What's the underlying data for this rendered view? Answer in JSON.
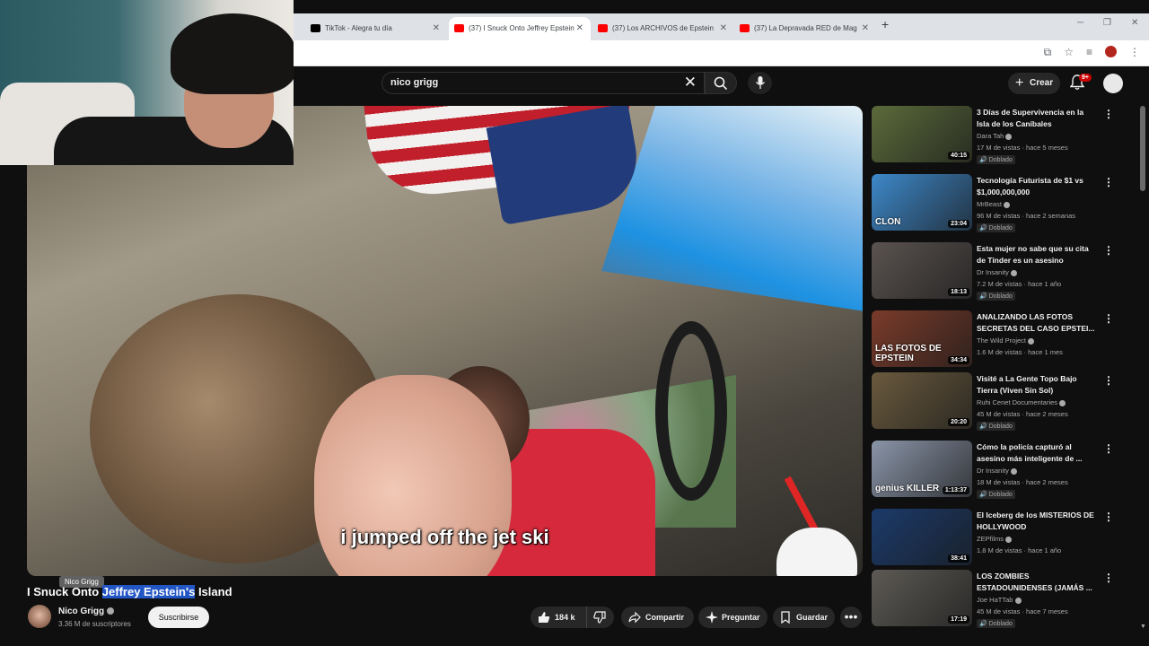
{
  "browser": {
    "tabs": [
      {
        "title": "TikTok - Alegra tu día",
        "icon": "tiktok-icon"
      },
      {
        "title": "(37) I Snuck Onto Jeffrey Epstein",
        "icon": "youtube-icon"
      },
      {
        "title": "(37) Los ARCHIVOS de Epstein",
        "icon": "youtube-icon"
      },
      {
        "title": "(37) La Depravada RED de Mag",
        "icon": "youtube-icon"
      }
    ],
    "close_glyph": "✕",
    "new_tab_glyph": "+"
  },
  "header": {
    "search_query": "nico grigg",
    "create_label": "Crear",
    "notification_badge": "9+"
  },
  "video": {
    "subtitle": "i jumped off the jet ski",
    "title_prefix": "I Snuck Onto ",
    "title_highlight": "Jeffrey Epstein's",
    "title_suffix": " Island",
    "channel_tooltip": "Nico Grigg",
    "channel_name": "Nico Grigg",
    "subscribers": "3.36 M de suscriptores",
    "subscribe_label": "Suscribirse",
    "likes": "184 k",
    "share_label": "Compartir",
    "ask_label": "Preguntar",
    "save_label": "Guardar",
    "more_glyph": "•••"
  },
  "recommendations": [
    {
      "title": "3 Días de Supervivencia en la Isla de los Caníbales",
      "channel": "Dara Tah",
      "meta": "17 M de vistas · hace 5 meses",
      "badge": "Doblado",
      "duration": "40:15",
      "thumb_color": "#5b6b3a"
    },
    {
      "title": "Tecnología Futurista de $1 vs $1,000,000,000",
      "channel": "MrBeast",
      "meta": "96 M de vistas · hace 2 semanas",
      "badge": "Doblado",
      "duration": "23:04",
      "thumb_color": "#3d88c9",
      "thumb_text": "CLON"
    },
    {
      "title": "Esta mujer no sabe que su cita de Tinder es un asesino",
      "channel": "Dr Insanity",
      "meta": "7.2 M de vistas · hace 1 año",
      "badge": "Doblado",
      "duration": "18:13",
      "thumb_color": "#5a5350"
    },
    {
      "title": "ANALIZANDO LAS FOTOS SECRETAS DEL CASO EPSTEI...",
      "channel": "The Wild Project",
      "meta": "1.6 M de vistas · hace 1 mes",
      "badge": "",
      "duration": "34:34",
      "thumb_color": "#7a3b2a",
      "thumb_text": "LAS FOTOS DE EPSTEIN"
    },
    {
      "title": "Visité a La Gente Topo Bajo Tierra (Viven Sin Sol)",
      "channel": "Ruhi Cenet Documentaries",
      "meta": "45 M de vistas · hace 2 meses",
      "badge": "Doblado",
      "duration": "20:20",
      "thumb_color": "#6a5a3e"
    },
    {
      "title": "Cómo la policía capturó al asesino más inteligente de ...",
      "channel": "Dr Insanity",
      "meta": "18 M de vistas · hace 2 meses",
      "badge": "Doblado",
      "duration": "1:13:37",
      "thumb_color": "#8a95a8",
      "thumb_text": "genius KILLER"
    },
    {
      "title": "El Iceberg de los MISTERIOS DE HOLLYWOOD",
      "channel": "ZEPfilms",
      "meta": "1.8 M de vistas · hace 1 año",
      "badge": "",
      "duration": "38:41",
      "thumb_color": "#1b3a6a"
    },
    {
      "title": "LOS ZOMBIES ESTADOUNIDENSES (JAMÁS ...",
      "channel": "Joe HaTTab",
      "meta": "45 M de vistas · hace 7 meses",
      "badge": "Doblado",
      "duration": "17:19",
      "thumb_color": "#5d5a55"
    }
  ]
}
